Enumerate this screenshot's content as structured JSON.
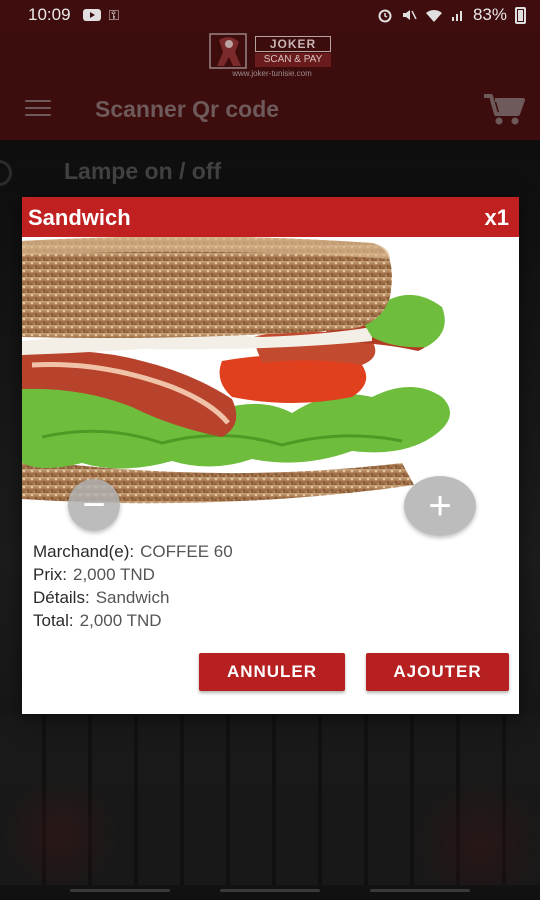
{
  "status_bar": {
    "time": "10:09",
    "battery": "83%",
    "icons": [
      "youtube-icon",
      "key-icon",
      "alarm-icon",
      "mute-icon",
      "wifi-icon",
      "signal-icon",
      "battery-icon"
    ]
  },
  "header": {
    "logo": {
      "joker": "JOKER",
      "scan_pay": "SCAN & PAY",
      "url": "www.joker-tunisie.com"
    },
    "title": "Scanner Qr code"
  },
  "background": {
    "lamp_label": "Lampe on / off"
  },
  "dialog": {
    "title": "Sandwich",
    "quantity": "x1",
    "info": [
      {
        "label": "Marchand(e):",
        "value": "COFFEE 60"
      },
      {
        "label": "Prix:",
        "value": "2,000 TND"
      },
      {
        "label": "Détails:",
        "value": "Sandwich"
      },
      {
        "label": "Total:",
        "value": "2,000 TND"
      }
    ],
    "cancel_label": "ANNULER",
    "add_label": "AJOUTER",
    "minus_symbol": "−",
    "plus_symbol": "+"
  },
  "colors": {
    "header_bg": "#3d0c0c",
    "accent_red": "#c0201f",
    "button_red": "#b72020"
  }
}
